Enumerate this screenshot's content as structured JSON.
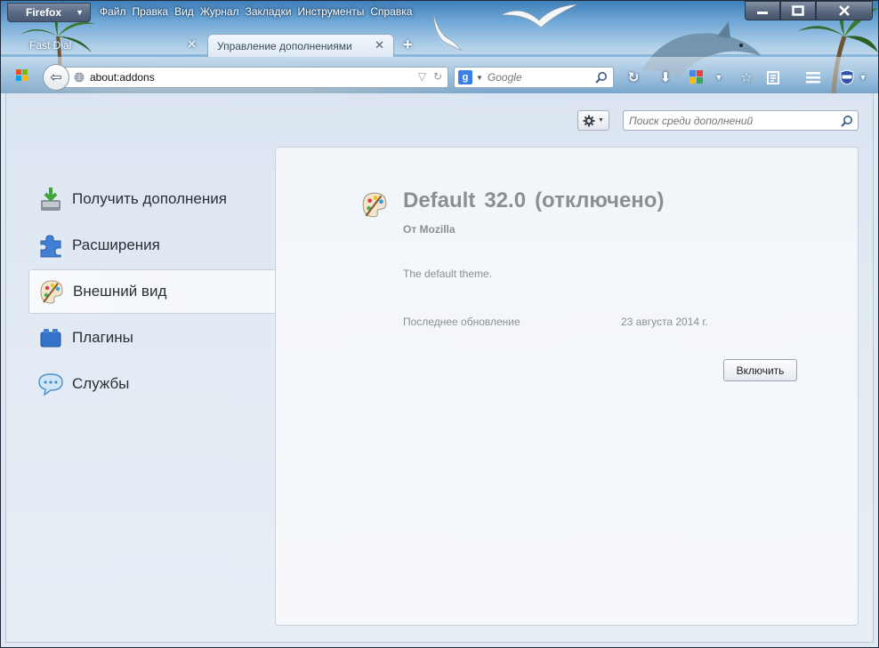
{
  "window": {
    "firefox_button_label": "Firefox",
    "controls": {
      "minimize": "—",
      "maximize": "□",
      "close": "✕"
    }
  },
  "menubar": {
    "items": [
      {
        "label": "Файл"
      },
      {
        "label": "Правка"
      },
      {
        "label": "Вид"
      },
      {
        "label": "Журнал"
      },
      {
        "label": "Закладки"
      },
      {
        "label": "Инструменты"
      },
      {
        "label": "Справка"
      }
    ]
  },
  "tabs": [
    {
      "label": "Fast Dial",
      "active": false
    },
    {
      "label": "Управление дополнениями",
      "active": true
    }
  ],
  "navbar": {
    "url": "about:addons",
    "search_placeholder": "Google",
    "search_engine_icon": "google-icon"
  },
  "addons": {
    "search_placeholder": "Поиск среди дополнений",
    "categories": [
      {
        "label": "Получить дополнения",
        "icon": "get-addons-icon"
      },
      {
        "label": "Расширения",
        "icon": "puzzle-icon"
      },
      {
        "label": "Внешний вид",
        "icon": "palette-icon",
        "selected": true
      },
      {
        "label": "Плагины",
        "icon": "plugin-brick-icon"
      },
      {
        "label": "Службы",
        "icon": "speech-bubble-icon"
      }
    ],
    "detail": {
      "name": "Default",
      "version": "32.0",
      "status": "(отключено)",
      "author": "От Mozilla",
      "description": "The default theme.",
      "update_label": "Последнее обновление",
      "update_value": "23 августа 2014 г.",
      "enable_button": "Включить"
    }
  }
}
